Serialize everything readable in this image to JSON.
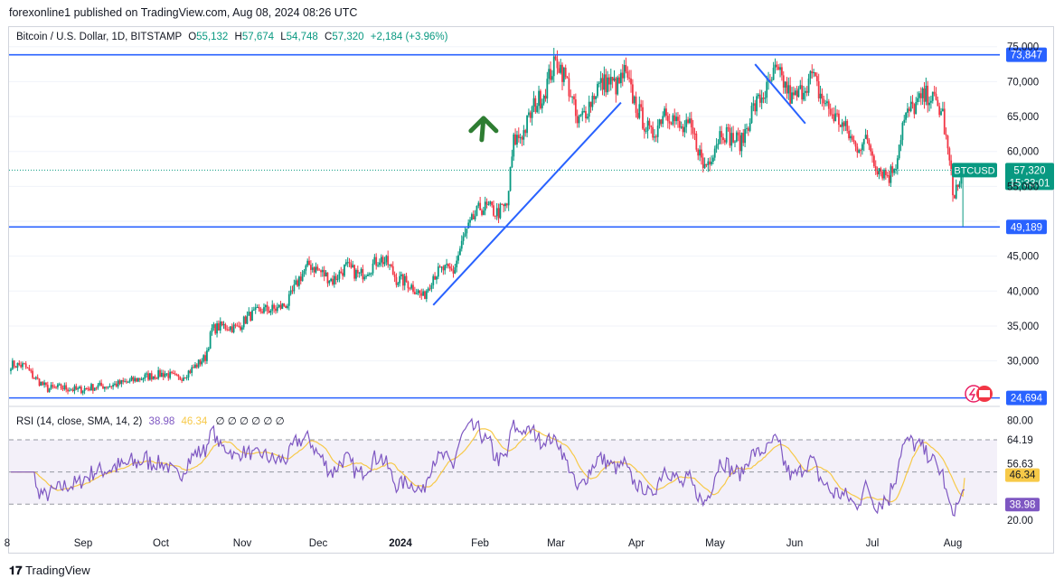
{
  "publisher_line": "forexonline1 published on TradingView.com, Aug 08, 2024 08:26 UTC",
  "symbol_header": {
    "name": "Bitcoin / U.S. Dollar, 1D, BITSTAMP",
    "o_label": "O",
    "o": "55,132",
    "h_label": "H",
    "h": "57,674",
    "l_label": "L",
    "l": "54,748",
    "c_label": "C",
    "c": "57,320",
    "change": "+2,184 (+3.96%)"
  },
  "rsi_header": {
    "label": "RSI (14, close, SMA, 14, 2)",
    "rsi": "38.98",
    "sma": "46.34",
    "na": "∅  ∅  ∅  ∅  ∅  ∅"
  },
  "footer_brand": "TradingView",
  "colors": {
    "up": "#089981",
    "down": "#f23645",
    "hline": "#2962ff",
    "rsi": "#7e57c2",
    "rsi_ma": "#f7c948",
    "arrow": "#2e7d32"
  },
  "chart_data": {
    "type": "candlestick",
    "price_axis": {
      "ticks": [
        24694,
        30000,
        35000,
        40000,
        45000,
        50000,
        55000,
        60000,
        65000,
        70000,
        75000
      ],
      "tick_labels": [
        "24,694",
        "30,000",
        "35,000",
        "40,000",
        "45,000",
        "49,189",
        "55,000",
        "60,000",
        "65,000",
        "70,000",
        "75,000"
      ],
      "ylim": [
        24000,
        76000
      ]
    },
    "time_axis": {
      "labels": [
        "8",
        "Sep",
        "Oct",
        "Nov",
        "Dec",
        "2024",
        "Feb",
        "Mar",
        "Apr",
        "May",
        "Jun",
        "Jul",
        "Aug"
      ]
    },
    "horizontal_levels": [
      {
        "value": 73847,
        "label": "73,847"
      },
      {
        "value": 49189,
        "label": "49,189"
      },
      {
        "value": 24694,
        "label": "24,694"
      }
    ],
    "current_price": {
      "value": 57320,
      "label": "57,320",
      "symbol": "BTCUSD",
      "countdown": "15:33:01"
    },
    "series_anchors": [
      [
        0,
        29500
      ],
      [
        8,
        29300
      ],
      [
        14,
        27600
      ],
      [
        22,
        26000
      ],
      [
        30,
        26200
      ],
      [
        40,
        25800
      ],
      [
        50,
        26300
      ],
      [
        60,
        26500
      ],
      [
        70,
        27000
      ],
      [
        80,
        27700
      ],
      [
        92,
        28200
      ],
      [
        100,
        27400
      ],
      [
        108,
        28800
      ],
      [
        116,
        30500
      ],
      [
        120,
        34500
      ],
      [
        126,
        35000
      ],
      [
        135,
        34700
      ],
      [
        142,
        36400
      ],
      [
        150,
        37300
      ],
      [
        158,
        37400
      ],
      [
        165,
        38200
      ],
      [
        172,
        41800
      ],
      [
        178,
        43800
      ],
      [
        185,
        42700
      ],
      [
        192,
        41500
      ],
      [
        200,
        43500
      ],
      [
        208,
        42200
      ],
      [
        215,
        43500
      ],
      [
        220,
        44700
      ],
      [
        225,
        43900
      ],
      [
        230,
        41700
      ],
      [
        236,
        41300
      ],
      [
        242,
        40100
      ],
      [
        246,
        39100
      ],
      [
        252,
        42300
      ],
      [
        258,
        43100
      ],
      [
        264,
        42800
      ],
      [
        270,
        47500
      ],
      [
        276,
        50400
      ],
      [
        280,
        51900
      ],
      [
        285,
        51900
      ],
      [
        290,
        51200
      ],
      [
        296,
        52200
      ],
      [
        300,
        61400
      ],
      [
        306,
        62800
      ],
      [
        312,
        66500
      ],
      [
        318,
        68300
      ],
      [
        322,
        71300
      ],
      [
        326,
        73000
      ],
      [
        330,
        71000
      ],
      [
        334,
        68400
      ],
      [
        338,
        63800
      ],
      [
        342,
        65500
      ],
      [
        346,
        67200
      ],
      [
        350,
        69300
      ],
      [
        356,
        70000
      ],
      [
        362,
        69300
      ],
      [
        366,
        71200
      ],
      [
        370,
        68500
      ],
      [
        374,
        65900
      ],
      [
        378,
        64100
      ],
      [
        382,
        62200
      ],
      [
        386,
        63800
      ],
      [
        390,
        66200
      ],
      [
        395,
        64800
      ],
      [
        400,
        63000
      ],
      [
        405,
        63400
      ],
      [
        410,
        60600
      ],
      [
        413,
        57800
      ],
      [
        416,
        58600
      ],
      [
        420,
        60800
      ],
      [
        424,
        63100
      ],
      [
        430,
        61900
      ],
      [
        436,
        61300
      ],
      [
        442,
        65800
      ],
      [
        446,
        67200
      ],
      [
        452,
        69100
      ],
      [
        456,
        71400
      ],
      [
        460,
        70300
      ],
      [
        466,
        67400
      ],
      [
        470,
        68100
      ],
      [
        474,
        69600
      ],
      [
        478,
        70800
      ],
      [
        482,
        68500
      ],
      [
        486,
        66800
      ],
      [
        490,
        65300
      ],
      [
        495,
        64200
      ],
      [
        500,
        62400
      ],
      [
        504,
        60500
      ],
      [
        508,
        61500
      ],
      [
        512,
        61200
      ],
      [
        516,
        58100
      ],
      [
        520,
        57200
      ],
      [
        524,
        56500
      ],
      [
        528,
        58500
      ],
      [
        532,
        63800
      ],
      [
        536,
        65800
      ],
      [
        540,
        66700
      ],
      [
        544,
        67600
      ],
      [
        548,
        68200
      ],
      [
        552,
        66700
      ],
      [
        556,
        65300
      ],
      [
        558,
        61400
      ],
      [
        560,
        58500
      ],
      [
        562,
        54200
      ],
      [
        566,
        55100
      ],
      [
        569,
        57320
      ]
    ],
    "candle_count": 570,
    "annotations": [
      {
        "type": "trendline",
        "from": [
          252,
          38000
        ],
        "to": [
          364,
          67000
        ]
      },
      {
        "type": "trendline",
        "from": [
          444,
          72500
        ],
        "to": [
          474,
          64000
        ]
      },
      {
        "type": "arrow_up",
        "at": [
          282,
          64500
        ]
      }
    ],
    "rsi_panel": {
      "params": "RSI (14, close, SMA, 14, 2)",
      "ticks": [
        "80.00",
        "64.19",
        "56.63",
        "46.34",
        "38.98",
        "20.00"
      ],
      "levels": {
        "upper": 70,
        "middle": 50,
        "lower": 30
      },
      "ylim": [
        15,
        88
      ],
      "rsi_last": 38.98,
      "sma_last": 46.34
    }
  }
}
